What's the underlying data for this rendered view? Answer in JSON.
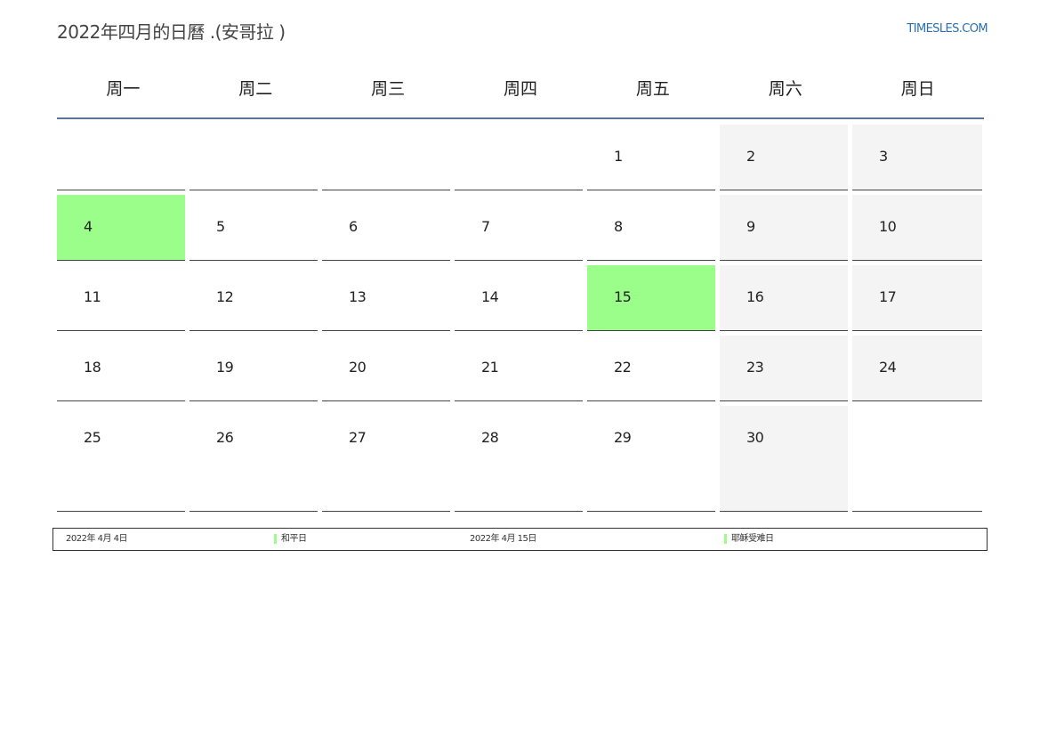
{
  "header": {
    "title": "2022年四月的日曆 .(安哥拉 )",
    "site": "TIMESLES.COM"
  },
  "weekdays": [
    "周一",
    "周二",
    "周三",
    "周四",
    "周五",
    "周六",
    "周日"
  ],
  "weeks": [
    [
      "",
      "",
      "",
      "",
      "1",
      "2",
      "3"
    ],
    [
      "4",
      "5",
      "6",
      "7",
      "8",
      "9",
      "10"
    ],
    [
      "11",
      "12",
      "13",
      "14",
      "15",
      "16",
      "17"
    ],
    [
      "18",
      "19",
      "20",
      "21",
      "22",
      "23",
      "24"
    ],
    [
      "25",
      "26",
      "27",
      "28",
      "29",
      "30",
      ""
    ]
  ],
  "highlight_days": [
    "4",
    "15"
  ],
  "colors": {
    "holiday": "#9bfd8a",
    "weekend": "#f4f4f4",
    "header_rule": "#5a7596",
    "site_link": "#2a6fb0"
  },
  "legend": [
    {
      "date": "2022年 4月 4日",
      "name": "和平日"
    },
    {
      "date": "2022年 4月 15日",
      "name": "耶稣受难日"
    }
  ]
}
